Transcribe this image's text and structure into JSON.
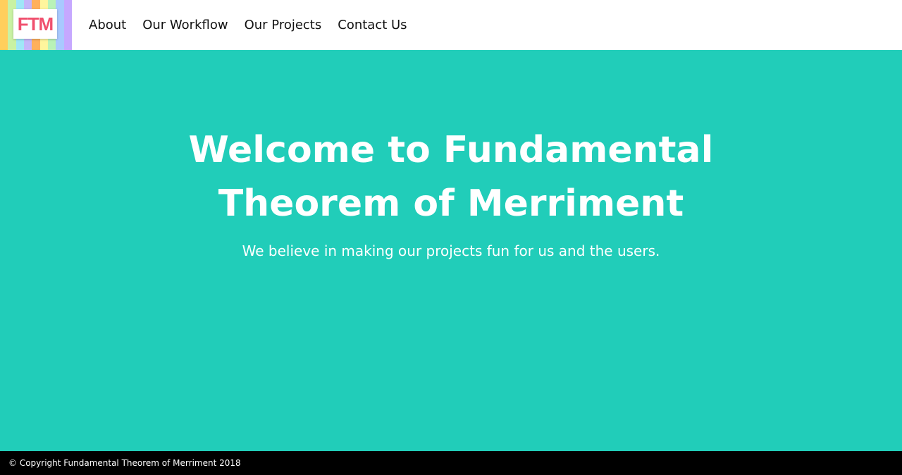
{
  "header": {
    "logo_text": "FTM",
    "logo_stripe_colors": [
      "#ffcf5c",
      "#c9f2a3",
      "#9fe6f7",
      "#c3b6f9",
      "#ffb05c",
      "#fff59d",
      "#b9f2b8",
      "#a9c9ff",
      "#c6a8ff"
    ],
    "logo_text_color": "#f0506e"
  },
  "nav": {
    "items": [
      {
        "label": "About"
      },
      {
        "label": "Our Workflow"
      },
      {
        "label": "Our Projects"
      },
      {
        "label": "Contact Us"
      }
    ]
  },
  "hero": {
    "title": "Welcome to Fundamental Theorem of Merriment",
    "subtitle": "We believe in making our projects fun for us and the users.",
    "background_color": "#21cdb9"
  },
  "footer": {
    "text": "© Copyright Fundamental Theorem of Merriment 2018"
  }
}
